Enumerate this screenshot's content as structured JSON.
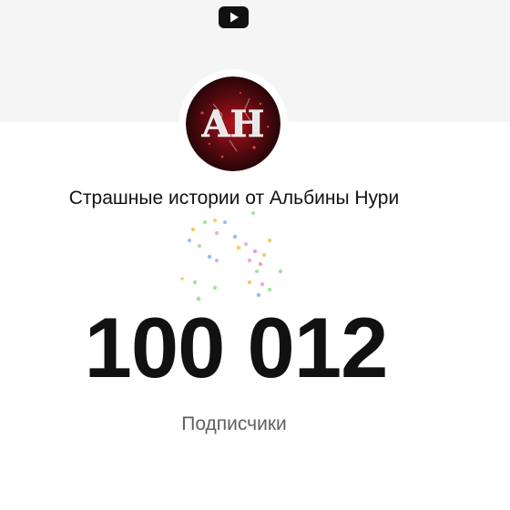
{
  "channel": {
    "name": "Страшные истории от Альбины Нури",
    "avatar_text": "AH",
    "subscriber_count": "100 012",
    "subscriber_label": "Подписчики"
  },
  "icons": {
    "top": "youtube-logo-icon",
    "avatar": "channel-avatar"
  },
  "colors": {
    "banner": "#f5f5f5",
    "count_text": "#111111",
    "label_text": "#606060",
    "avatar_bg": "#3a0a0c",
    "avatar_glow": "#b3121b"
  }
}
